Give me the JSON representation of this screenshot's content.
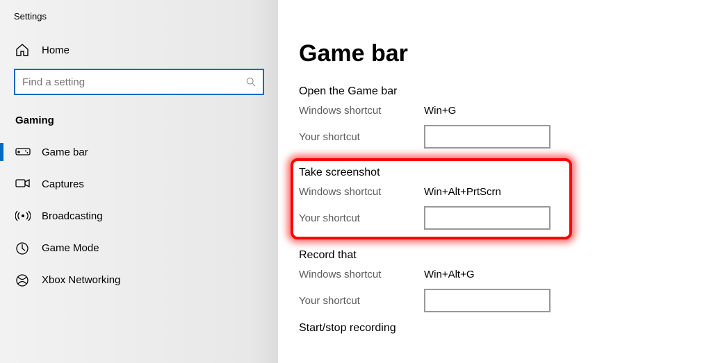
{
  "app_title": "Settings",
  "sidebar": {
    "home_label": "Home",
    "search_placeholder": "Find a setting",
    "section": "Gaming",
    "items": [
      {
        "label": "Game bar"
      },
      {
        "label": "Captures"
      },
      {
        "label": "Broadcasting"
      },
      {
        "label": "Game Mode"
      },
      {
        "label": "Xbox Networking"
      }
    ]
  },
  "content": {
    "title": "Game bar",
    "groups": [
      {
        "title": "Open the Game bar",
        "win_label": "Windows shortcut",
        "win_value": "Win+G",
        "your_label": "Your shortcut"
      },
      {
        "title": "Take screenshot",
        "win_label": "Windows shortcut",
        "win_value": "Win+Alt+PrtScrn",
        "your_label": "Your shortcut"
      },
      {
        "title": "Record that",
        "win_label": "Windows shortcut",
        "win_value": "Win+Alt+G",
        "your_label": "Your shortcut"
      },
      {
        "title": "Start/stop recording"
      }
    ]
  }
}
